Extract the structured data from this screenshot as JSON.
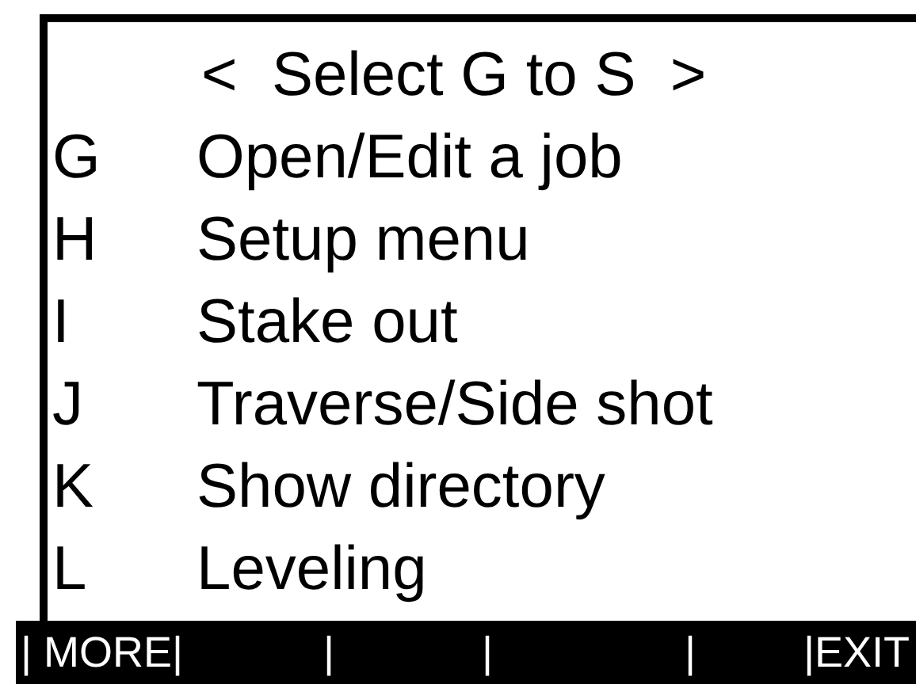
{
  "title": "<  Select G to S  >",
  "menu_items": [
    {
      "key": "G",
      "label": "Open/Edit a job"
    },
    {
      "key": "H",
      "label": "Setup menu"
    },
    {
      "key": "I",
      "label": "Stake out"
    },
    {
      "key": "J",
      "label": "Traverse/Side shot"
    },
    {
      "key": "K",
      "label": "Show directory"
    },
    {
      "key": "L",
      "label": "Leveling"
    }
  ],
  "softkeys": [
    "| MORE|",
    "|",
    "|",
    "|",
    "|EXIT"
  ]
}
